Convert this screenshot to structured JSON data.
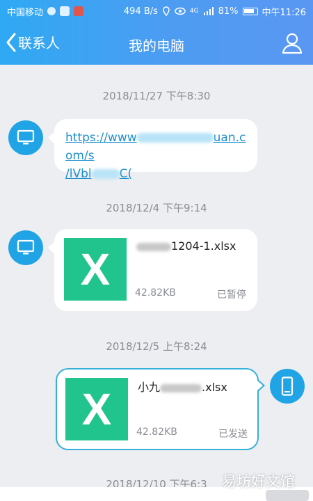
{
  "status_bar": {
    "carrier": "中国移动",
    "net_speed": "494 B/s",
    "signal": "4G",
    "battery": "81%",
    "time": "中午11:26"
  },
  "header": {
    "back_label": "联系人",
    "title": "我的电脑",
    "icons": {
      "back": "chevron-left-icon",
      "profile": "person-icon"
    }
  },
  "messages": [
    {
      "timestamp": "2018/11/27 下午8:30",
      "side": "left",
      "type": "link",
      "link_visible_start": "https://www",
      "link_visible_mid": "uan.com/s",
      "link_line2_start": "/lVbl",
      "link_line2_end": "C("
    },
    {
      "timestamp": "2018/12/4 下午9:14",
      "side": "left",
      "type": "file",
      "file_name_visible": "1204-1.xlsx",
      "file_size": "42.82KB",
      "file_status": "已暂停",
      "file_icon_letter": "X"
    },
    {
      "timestamp": "2018/12/5 上午8:24",
      "side": "right",
      "type": "file",
      "file_name_prefix": "小九",
      "file_name_suffix": ".xlsx",
      "file_size": "42.82KB",
      "file_status": "已发送",
      "file_icon_letter": "X"
    }
  ],
  "partial_timestamp": "2018/12/10 下午6:3",
  "watermark": "易坊好文馆",
  "colors": {
    "header_start": "#2fa9f3",
    "header_end": "#5a97f2",
    "avatar": "#21a4e6",
    "excel_green": "#21c48c",
    "link": "#1d8fd0",
    "sent_border": "#35b0d8"
  }
}
